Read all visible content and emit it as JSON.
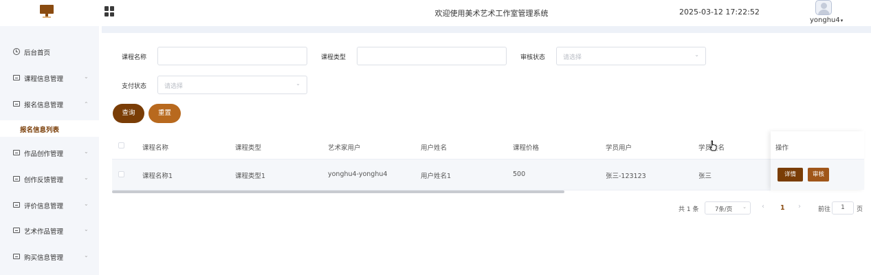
{
  "header": {
    "site_title": "欢迎使用美术艺术工作室管理系统",
    "datetime": "2025-03-12 17:22:52",
    "username": "yonghu4",
    "caret": "▾"
  },
  "sidebar": {
    "items": [
      {
        "label": "后台首页",
        "arrow": ""
      },
      {
        "label": "课程信息管理",
        "arrow": "⌄"
      },
      {
        "label": "报名信息管理",
        "arrow": "⌃"
      },
      {
        "label": "作品创作管理",
        "arrow": "⌄"
      },
      {
        "label": "创作反馈管理",
        "arrow": "⌄"
      },
      {
        "label": "评价信息管理",
        "arrow": "⌄"
      },
      {
        "label": "艺术作品管理",
        "arrow": "⌄"
      },
      {
        "label": "购买信息管理",
        "arrow": "⌄"
      }
    ],
    "active_sub": "报名信息列表"
  },
  "filters": {
    "course_name_label": "课程名称",
    "course_type_label": "课程类型",
    "review_status_label": "审核状态",
    "review_status_placeholder": "请选择",
    "pay_status_label": "支付状态",
    "pay_status_placeholder": "请选择",
    "search_label": "查询",
    "reset_label": "重置",
    "dropdown_arrow": "⌄"
  },
  "table": {
    "headers": [
      "课程名称",
      "课程类型",
      "艺术家用户",
      "用户姓名",
      "课程价格",
      "学员用户",
      "学员姓名",
      "操作"
    ],
    "rows": [
      {
        "cells": [
          "课程名称1",
          "课程类型1",
          "yonghu4-yonghu4",
          "用户姓名1",
          "500",
          "张三-123123",
          "张三"
        ],
        "detail_label": "详情",
        "review_label": "审核"
      }
    ]
  },
  "pagination": {
    "total": "共 1 条",
    "page_size": "7条/页",
    "prev": "‹",
    "current": "1",
    "next": "›",
    "goto_prefix": "前往",
    "goto_value": "1",
    "goto_suffix": "页"
  },
  "colors": {
    "brand_dark": "#7a3d06",
    "brand_orange": "#b8691e",
    "accent": "#8a4b10"
  }
}
